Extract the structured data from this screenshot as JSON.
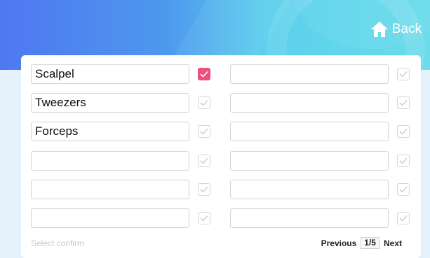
{
  "header": {
    "back_label": "Back"
  },
  "rows": [
    {
      "left_value": "Scalpel",
      "left_checked": true,
      "right_value": "",
      "right_checked": false
    },
    {
      "left_value": "Tweezers",
      "left_checked": false,
      "right_value": "",
      "right_checked": false
    },
    {
      "left_value": "Forceps",
      "left_checked": false,
      "right_value": "",
      "right_checked": false
    },
    {
      "left_value": "",
      "left_checked": false,
      "right_value": "",
      "right_checked": false
    },
    {
      "left_value": "",
      "left_checked": false,
      "right_value": "",
      "right_checked": false
    },
    {
      "left_value": "",
      "left_checked": false,
      "right_value": "",
      "right_checked": false
    }
  ],
  "footer": {
    "confirm_label": "Select confirm"
  },
  "pagination": {
    "previous_label": "Previous",
    "page_indicator": "1/5",
    "next_label": "Next"
  },
  "colors": {
    "accent": "#ee4f7d",
    "header_start": "#4f78f0",
    "header_end": "#6adcea"
  },
  "icons": {
    "back": "home-icon",
    "check": "checkmark-icon"
  }
}
